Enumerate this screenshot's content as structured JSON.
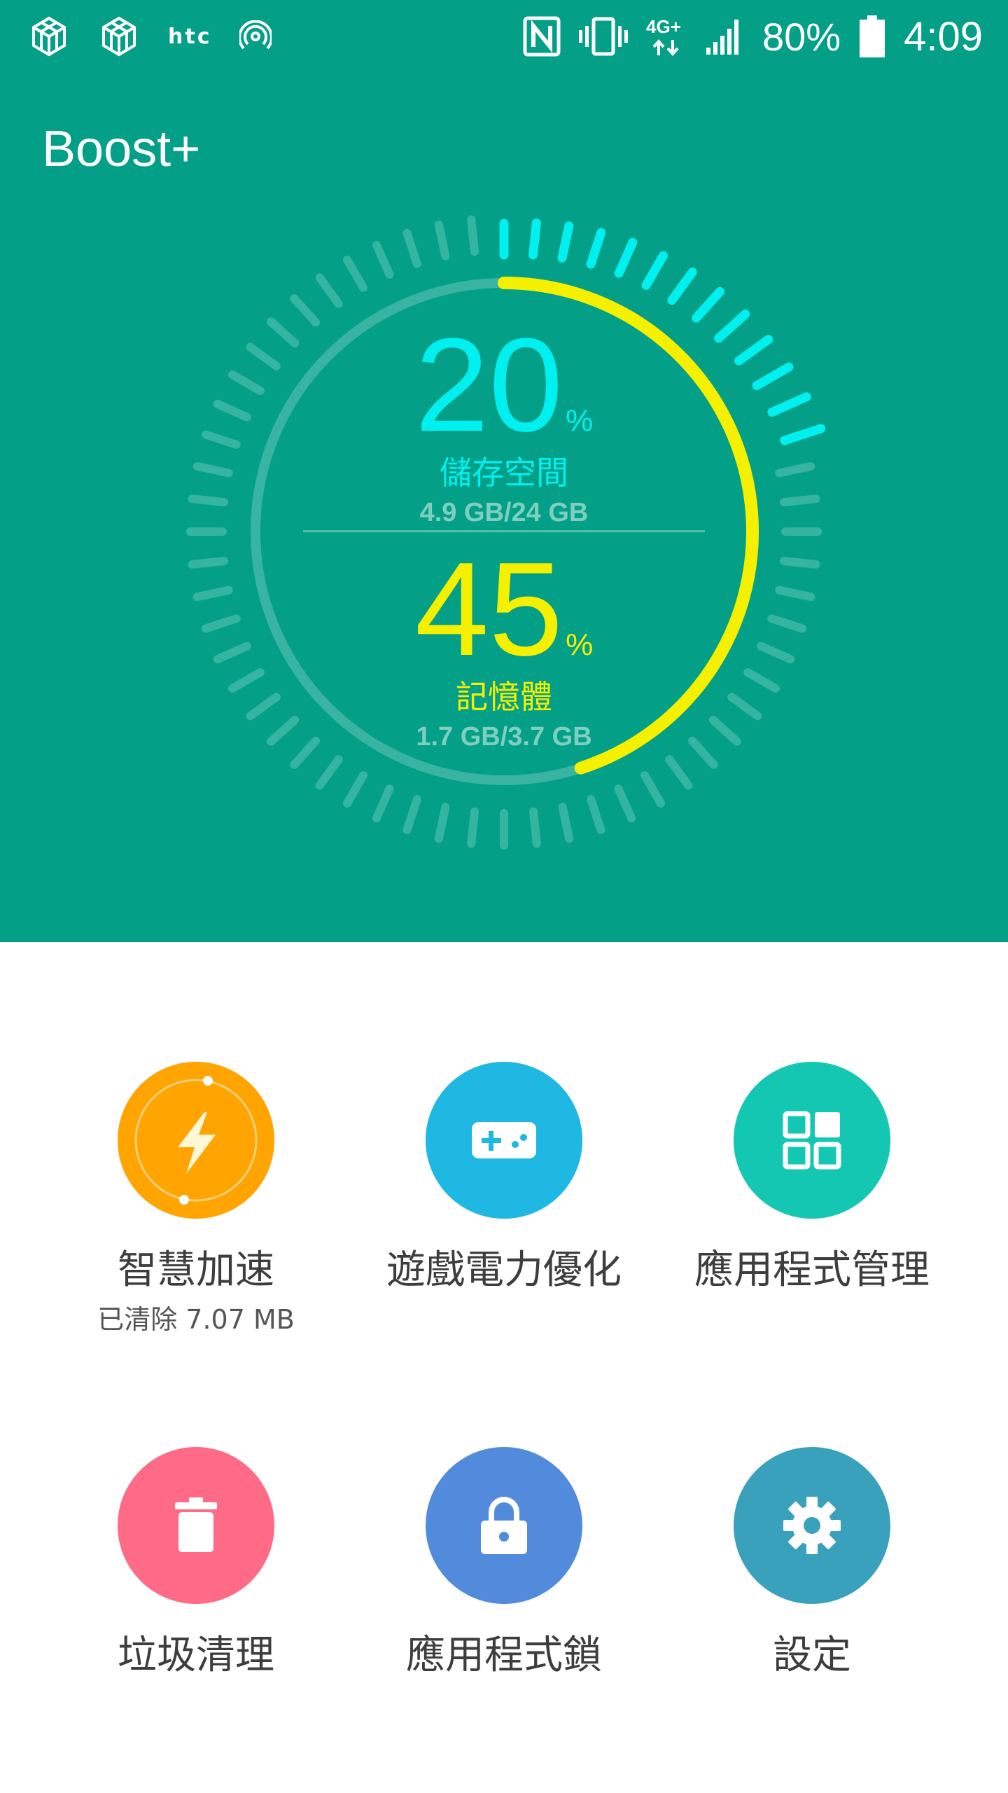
{
  "status_bar": {
    "carrier_logo": "htc",
    "network": "4G+",
    "battery": "80%",
    "time": "4:09",
    "icons": [
      "cube-icon",
      "cube-icon",
      "htc-logo",
      "hotspot-icon",
      "nfc-icon",
      "vibrate-icon",
      "network-4g-icon",
      "signal-icon",
      "battery-icon"
    ]
  },
  "app": {
    "title": "Boost+"
  },
  "gauge": {
    "storage": {
      "percent": "20",
      "percent_sign": "%",
      "label": "儲存空間",
      "detail": "4.9 GB/24 GB",
      "fraction": 0.2,
      "color": "#00f0f0"
    },
    "memory": {
      "percent": "45",
      "percent_sign": "%",
      "label": "記憶體",
      "detail": "1.7 GB/3.7 GB",
      "fraction": 0.45,
      "color": "#f5f000"
    }
  },
  "tiles": [
    {
      "label": "智慧加速",
      "sub": "已清除 7.07 MB",
      "icon": "lightning-icon",
      "color": "#ffa400"
    },
    {
      "label": "遊戲電力優化",
      "icon": "gamepad-icon",
      "color": "#1eb8e2"
    },
    {
      "label": "應用程式管理",
      "icon": "app-grid-icon",
      "color": "#14c7b2"
    },
    {
      "label": "垃圾清理",
      "icon": "trash-icon",
      "color": "#ff6b86"
    },
    {
      "label": "應用程式鎖",
      "icon": "lock-icon",
      "color": "#528bdc"
    },
    {
      "label": "設定",
      "icon": "gear-icon",
      "color": "#39a1bb"
    }
  ]
}
